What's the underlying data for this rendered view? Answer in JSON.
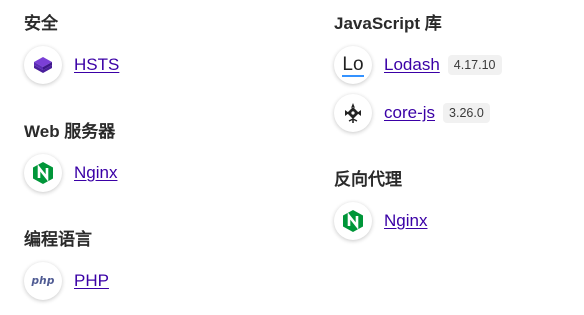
{
  "left_column": {
    "security": {
      "title": "安全",
      "items": [
        {
          "name": "HSTS",
          "icon": "hsts-icon"
        }
      ]
    },
    "web_servers": {
      "title": "Web 服务器",
      "items": [
        {
          "name": "Nginx",
          "icon": "nginx-icon"
        }
      ]
    },
    "languages": {
      "title": "编程语言",
      "items": [
        {
          "name": "PHP",
          "icon": "php-icon",
          "icon_text": "php"
        }
      ]
    }
  },
  "right_column": {
    "js_libraries": {
      "title": "JavaScript 库",
      "items": [
        {
          "name": "Lodash",
          "version": "4.17.10",
          "icon": "lodash-icon",
          "icon_text": "Lo"
        },
        {
          "name": "core-js",
          "version": "3.26.0",
          "icon": "core-js-icon"
        }
      ]
    },
    "reverse_proxies": {
      "title": "反向代理",
      "items": [
        {
          "name": "Nginx",
          "icon": "nginx-icon"
        }
      ]
    }
  },
  "colors": {
    "link": "#3a00a6",
    "heading": "#2b2b2b",
    "nginx_green": "#009639",
    "hsts_purple": "#5b2bb5",
    "php_blue": "#4f5b93",
    "lodash_blue": "#3492ff"
  }
}
